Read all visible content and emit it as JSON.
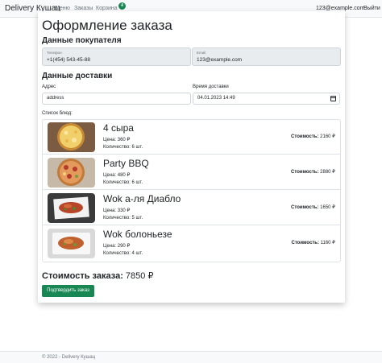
{
  "nav": {
    "brand": "Delivery Кушац",
    "links": [
      "Меню",
      "Заказы",
      "Корзина"
    ],
    "cart_count": "4",
    "email": "123@example.com",
    "logout": "Выйти"
  },
  "page": {
    "title": "Оформление заказа",
    "buyer_heading": "Данные покупателя",
    "phone_label": "Телефон",
    "phone_value": "+1(454) 543-45-88",
    "email_label": "Email",
    "email_value": "123@example.com",
    "delivery_heading": "Данные доставки",
    "address_label": "Адрес",
    "address_value": "address",
    "time_label": "Время доставки",
    "time_value": "04.01.2023 14:49",
    "dishes_label": "Список блюд:"
  },
  "dishes": [
    {
      "name": "4 сыра",
      "price": "Цена: 360 ₽",
      "qty": "Количество: 6 шт.",
      "cost_label": "Стоимость:",
      "cost": "2160 ₽",
      "image": "pizza-four-cheese"
    },
    {
      "name": "Party BBQ",
      "price": "Цена: 480 ₽",
      "qty": "Количество: 6 шт.",
      "cost_label": "Стоимость:",
      "cost": "2880 ₽",
      "image": "pizza-bbq"
    },
    {
      "name": "Wok а-ля Диабло",
      "price": "Цена: 330 ₽",
      "qty": "Количество: 5 шт.",
      "cost_label": "Стоимость:",
      "cost": "1650 ₽",
      "image": "wok-diablo"
    },
    {
      "name": "Wok болоньезе",
      "price": "Цена: 290 ₽",
      "qty": "Количество: 4 шт.",
      "cost_label": "Стоимость:",
      "cost": "1160 ₽",
      "image": "wok-bolognese"
    }
  ],
  "order": {
    "total_label": "Стоимость заказа:",
    "total_value": "7850 ₽",
    "confirm_label": "Подтвердить заказ"
  },
  "footer": {
    "text": "© 2022 - Delivery Кушац"
  },
  "colors": {
    "primary": "#198754",
    "navbar_bg": "#f8f9fa",
    "readonly_bg": "#e9ecef"
  }
}
